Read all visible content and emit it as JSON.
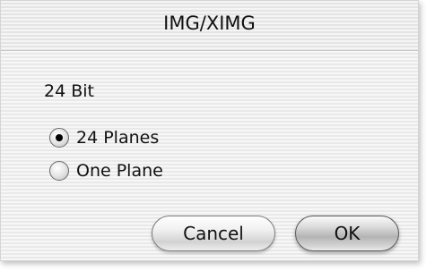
{
  "window": {
    "title": "IMG/XIMG"
  },
  "section_label": "24 Bit",
  "options": [
    {
      "label": "24 Planes",
      "selected": true
    },
    {
      "label": "One Plane",
      "selected": false
    }
  ],
  "buttons": {
    "cancel_label": "Cancel",
    "ok_label": "OK"
  },
  "icons": {
    "radio": "radio-button-icon"
  }
}
